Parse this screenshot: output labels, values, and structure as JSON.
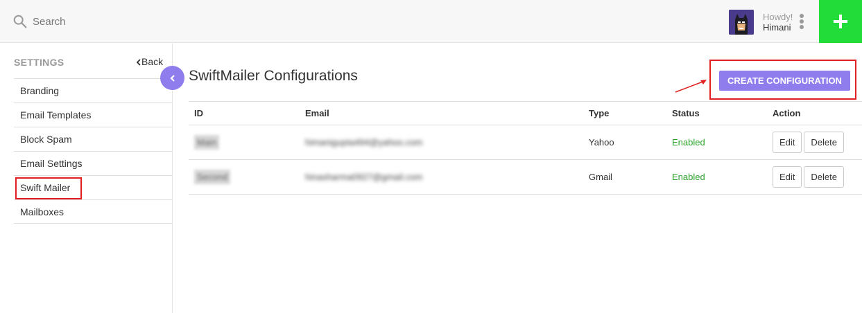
{
  "header": {
    "search_placeholder": "Search",
    "greeting": "Howdy!",
    "user_name": "Himani",
    "add_label": "+"
  },
  "sidebar": {
    "title": "SETTINGS",
    "back_label": "Back",
    "items": [
      {
        "label": "Branding"
      },
      {
        "label": "Email Templates"
      },
      {
        "label": "Block Spam"
      },
      {
        "label": "Email Settings"
      },
      {
        "label": "Swift Mailer"
      },
      {
        "label": "Mailboxes"
      }
    ]
  },
  "main": {
    "title": "SwiftMailer Configurations",
    "create_button": "CREATE CONFIGURATION",
    "columns": [
      "ID",
      "Email",
      "Type",
      "Status",
      "Action"
    ],
    "rows": [
      {
        "id": "Main",
        "email": "himanigupta494@yahoo.com",
        "type": "Yahoo",
        "status": "Enabled",
        "edit": "Edit",
        "delete": "Delete"
      },
      {
        "id": "Second",
        "email": "hinasharma0927@gmail.com",
        "type": "Gmail",
        "status": "Enabled",
        "edit": "Edit",
        "delete": "Delete"
      }
    ]
  },
  "colors": {
    "accent": "#8f7ded",
    "add_button": "#22dc3a",
    "highlight": "#e02020",
    "enabled": "#2aa32a"
  }
}
